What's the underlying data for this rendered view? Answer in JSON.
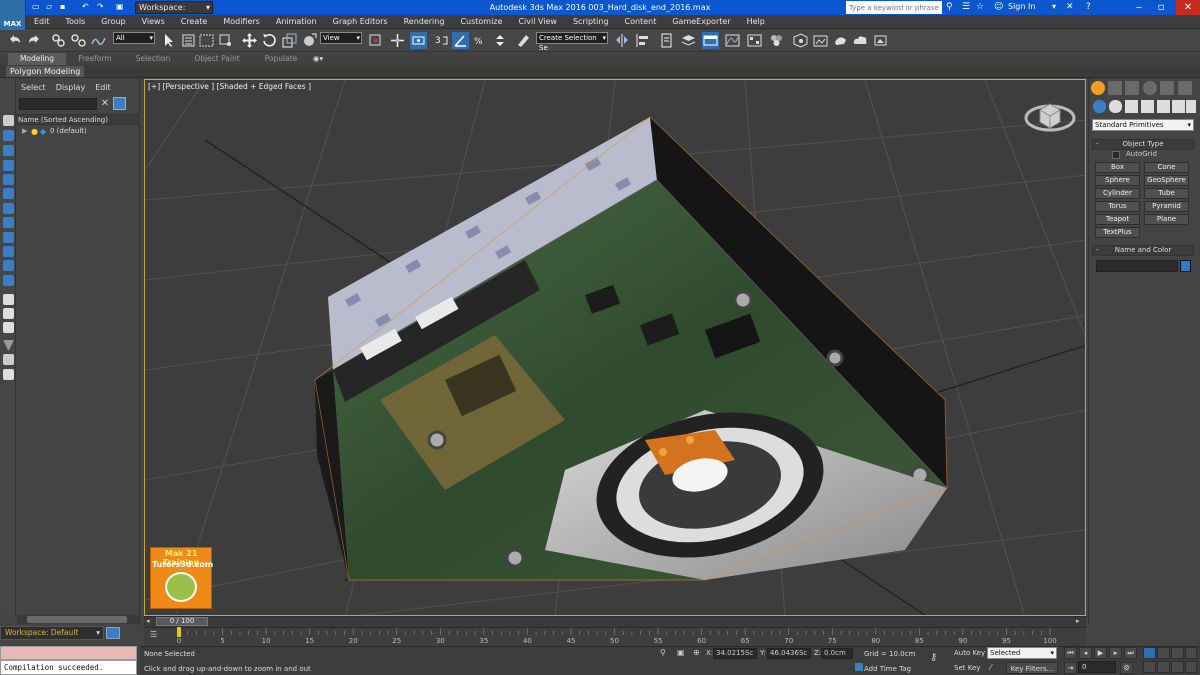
{
  "app": {
    "logo_text": "MAX",
    "workspace": "Workspace: Default",
    "window_title": "Autodesk 3ds Max 2016    003_Hard_disk_end_2016.max",
    "search_placeholder": "Type a keyword or phrase",
    "sign_in": "Sign In"
  },
  "menu": [
    "Edit",
    "Tools",
    "Group",
    "Views",
    "Create",
    "Modifiers",
    "Animation",
    "Graph Editors",
    "Rendering",
    "Customize",
    "Civil View",
    "Scripting",
    "Content",
    "GameExporter",
    "Help"
  ],
  "toolbar": {
    "selection_filter": "All",
    "ref_coord": "View",
    "named_selection": "Create Selection Se"
  },
  "ribbon": {
    "tabs": [
      "Modeling",
      "Freeform",
      "Selection",
      "Object Paint",
      "Populate"
    ],
    "active_tab": "Modeling",
    "panel": "Polygon Modeling"
  },
  "explorer": {
    "menu": [
      "Select",
      "Display",
      "Edit"
    ],
    "column_header": "Name (Sorted Ascending)",
    "rows": [
      {
        "name": "0 (default)"
      }
    ]
  },
  "viewport": {
    "label": "[+] [Perspective ] [Shaded + Edged Faces ]",
    "border_color": "#c8a838"
  },
  "watermark": {
    "line1": "Mak 21 Training",
    "line2": "Tutors3d.com"
  },
  "command_panel": {
    "category": "Standard Primitives",
    "object_type_title": "Object Type",
    "autogrid": "AutoGrid",
    "buttons": [
      "Box",
      "Cone",
      "Sphere",
      "GeoSphere",
      "Cylinder",
      "Tube",
      "Torus",
      "Pyramid",
      "Teapot",
      "Plane",
      "TextPlus"
    ],
    "name_color_title": "Name and Color",
    "object_color": "#2a7fd4"
  },
  "timeline": {
    "slider_label": "0 / 100",
    "ticks": [
      "0",
      "5",
      "10",
      "15",
      "20",
      "25",
      "30",
      "35",
      "40",
      "45",
      "50",
      "55",
      "60",
      "65",
      "70",
      "75",
      "80",
      "85",
      "90",
      "95",
      "100"
    ]
  },
  "status": {
    "workspace_bottom": "Workspace: Default",
    "maxscript_output": "Compilation succeeded.",
    "selection": "None Selected",
    "prompt": "Click and drag up-and-down to zoom in and out",
    "x_label": "X:",
    "x_value": "34.0215Sc",
    "y_label": "Y:",
    "y_value": "46.0436Sc",
    "z_label": "Z:",
    "z_value": "0.0cm",
    "grid": "Grid = 10.0cm",
    "add_time_tag": "Add Time Tag",
    "auto_key": "Auto Key",
    "set_key": "Set Key",
    "selected_set": "Selected",
    "key_filters": "Key Filters...",
    "frame": "0"
  }
}
